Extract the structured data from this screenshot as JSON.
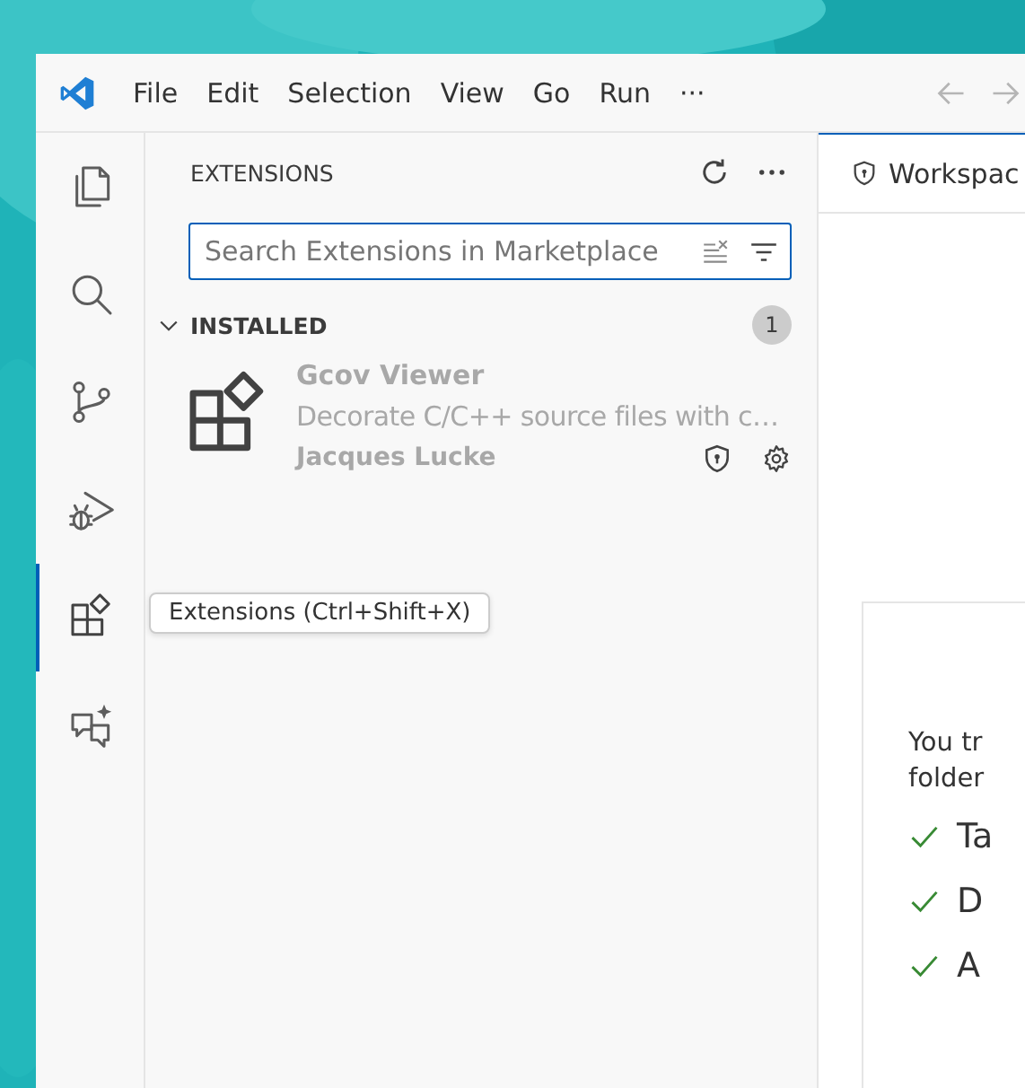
{
  "menu": [
    "File",
    "Edit",
    "Selection",
    "View",
    "Go",
    "Run",
    "···"
  ],
  "activity_bar": [
    {
      "kind": "files",
      "selected": false
    },
    {
      "kind": "search",
      "selected": false
    },
    {
      "kind": "source-control",
      "selected": false
    },
    {
      "kind": "run-debug",
      "selected": false
    },
    {
      "kind": "extensions",
      "selected": true
    },
    {
      "kind": "chat",
      "selected": false
    }
  ],
  "tooltip": "Extensions (Ctrl+Shift+X)",
  "sidebar": {
    "title": "EXTENSIONS",
    "search": {
      "placeholder": "Search Extensions in Marketplace"
    },
    "section": {
      "title": "INSTALLED",
      "expanded": true,
      "count": "1",
      "extensions": [
        {
          "name": "Gcov Viewer",
          "description": "Decorate C/C++ source files with c…",
          "publisher": "Jacques Lucke",
          "disabled": true
        }
      ]
    }
  },
  "editor": {
    "tab": "Workspac",
    "card": {
      "text_lines": [
        "You tr",
        "folder"
      ],
      "checks": [
        "Ta",
        "D",
        "A"
      ]
    }
  }
}
